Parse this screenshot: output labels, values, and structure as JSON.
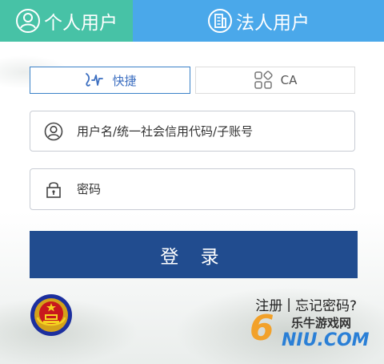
{
  "tabs": {
    "personal_label": "个人用户",
    "legal_label": "法人用户"
  },
  "login_methods": {
    "quick_label": "快捷",
    "ca_label": "CA"
  },
  "form": {
    "username_placeholder": "用户名/统一社会信用代码/子账号",
    "password_placeholder": "密码",
    "submit_label": "登 录"
  },
  "links": {
    "register": "注册",
    "separator": "|",
    "forgot_password": "忘记密码?"
  },
  "watermark": {
    "number": "6",
    "cn_text": "乐牛游戏网",
    "en_text": "NIU.COM"
  },
  "colors": {
    "personal_tab": "#47c2a6",
    "legal_tab": "#4aa8ea",
    "login_button": "#214c8f",
    "active_method_border": "#3b82c8"
  },
  "icons": {
    "personal_tab": "person-icon",
    "legal_tab": "building-icon",
    "quick": "handwave-icon",
    "ca": "certificate-nodes-icon",
    "username": "user-icon",
    "password": "lock-icon",
    "emblem": "national-emblem-icon"
  }
}
